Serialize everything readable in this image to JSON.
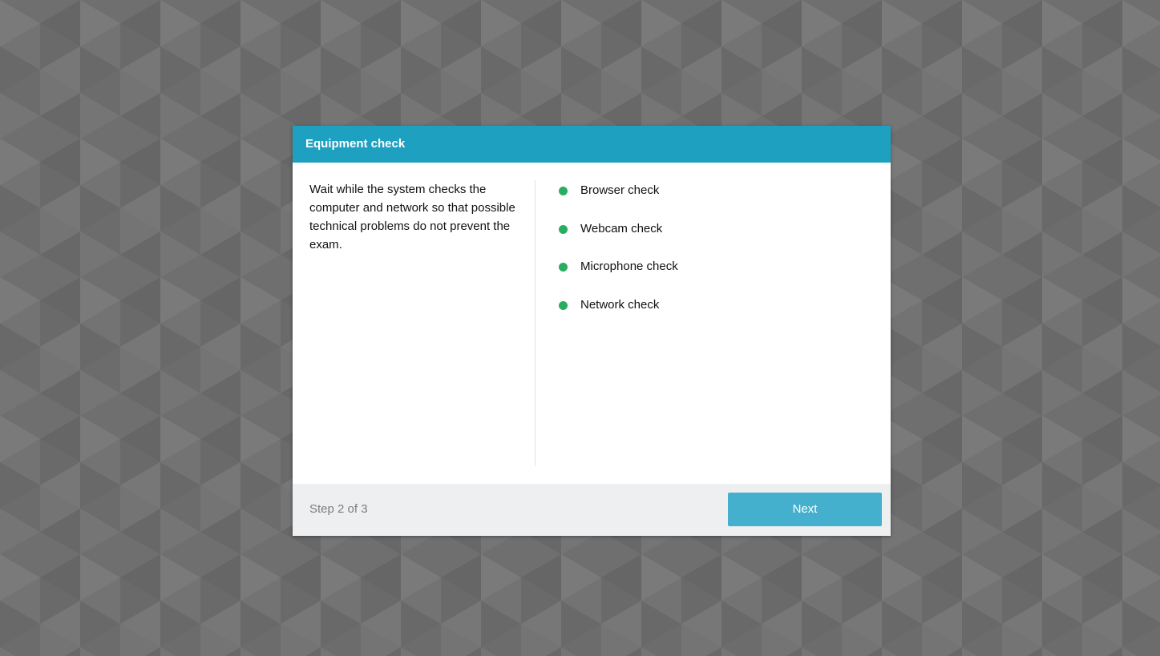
{
  "colors": {
    "background": "#6f6f6f",
    "header": "#1ea1c1",
    "next_button": "#44b0cd",
    "status_dot": "#27ae60",
    "footer": "#eeeff1"
  },
  "dialog": {
    "title": "Equipment check",
    "description": "Wait while the system checks the computer and network so that possible technical problems do not prevent the exam.",
    "checks": [
      {
        "label": "Browser check",
        "status": "ok",
        "icon": "status-dot-icon"
      },
      {
        "label": "Webcam check",
        "status": "ok",
        "icon": "status-dot-icon"
      },
      {
        "label": "Microphone check",
        "status": "ok",
        "icon": "status-dot-icon"
      },
      {
        "label": "Network check",
        "status": "ok",
        "icon": "status-dot-icon"
      }
    ],
    "footer": {
      "step_text": "Step 2 of 3",
      "next_label": "Next"
    }
  }
}
